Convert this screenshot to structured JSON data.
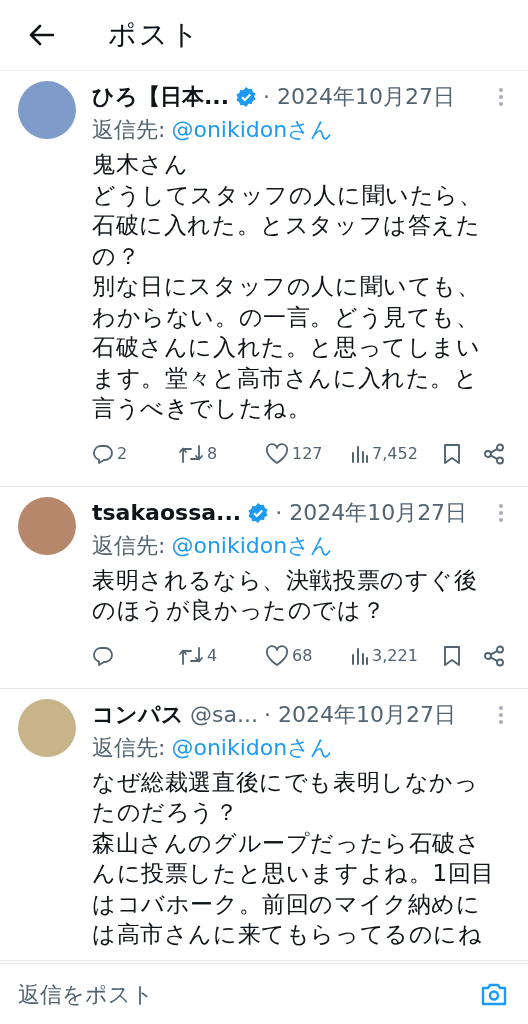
{
  "header": {
    "title": "ポスト"
  },
  "posts": [
    {
      "name": "ひろ【日本...",
      "verified": true,
      "date": "· 2024年10月27日",
      "reply_label": "返信先:",
      "reply_to": "@onikidonさん",
      "lines": [
        "鬼木さん",
        "どうしてスタッフの人に聞いたら、",
        "石破に入れた。とスタッフは答えた",
        "の？",
        "別な日にスタッフの人に聞いても、",
        "わからない。の一言。どう見ても、",
        "石破さんに入れた。と思ってしまい",
        "ます。堂々と高市さんに入れた。と",
        "言うべきでしたね。"
      ],
      "actions": {
        "replies": "2",
        "reposts": "8",
        "likes": "127",
        "views": "7,452"
      }
    },
    {
      "name": "tsakaossa...",
      "verified": true,
      "date": "· 2024年10月27日",
      "reply_label": "返信先:",
      "reply_to": "@onikidonさん",
      "lines": [
        "表明されるなら、決戦投票のすぐ後",
        "のほうが良かったのでは？"
      ],
      "actions": {
        "reposts": "4",
        "likes": "68",
        "views": "3,221"
      }
    },
    {
      "name": "コンパス",
      "verified": false,
      "handle": "@sa...",
      "date": "· 2024年10月27日",
      "reply_label": "返信先:",
      "reply_to": "@onikidonさん",
      "lines": [
        "なぜ総裁選直後にでも表明しなかっ",
        "たのだろう？",
        "森山さんのグループだったら石破さ",
        "んに投票したと思いますよね。1回目",
        "はコバホーク。前回のマイク納めに",
        "は高市さんに来てもらってるのにね"
      ]
    }
  ],
  "reply_bar": {
    "placeholder": "返信をポスト"
  }
}
